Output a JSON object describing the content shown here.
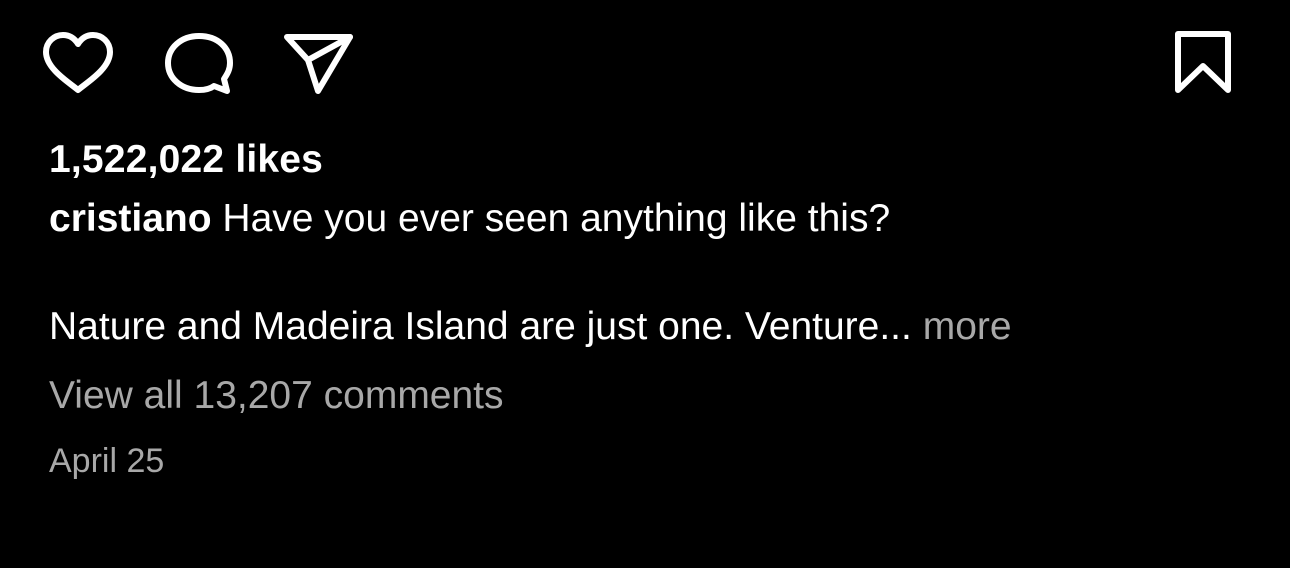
{
  "colors": {
    "background": "#000000",
    "text": "#ffffff",
    "secondary_text": "#a8a8a8"
  },
  "actions": {
    "like_icon": "heart-outline-icon",
    "comment_icon": "comment-bubble-icon",
    "share_icon": "paper-plane-icon",
    "save_icon": "bookmark-outline-icon"
  },
  "post": {
    "likes_text": "1,522,022 likes",
    "caption": {
      "username": "cristiano",
      "line1": "Have you ever seen anything like this?",
      "line2": "Nature and Madeira Island are just one. Venture...",
      "more_label": "more"
    },
    "view_comments_label": "View all 13,207 comments",
    "date": "April 25"
  }
}
